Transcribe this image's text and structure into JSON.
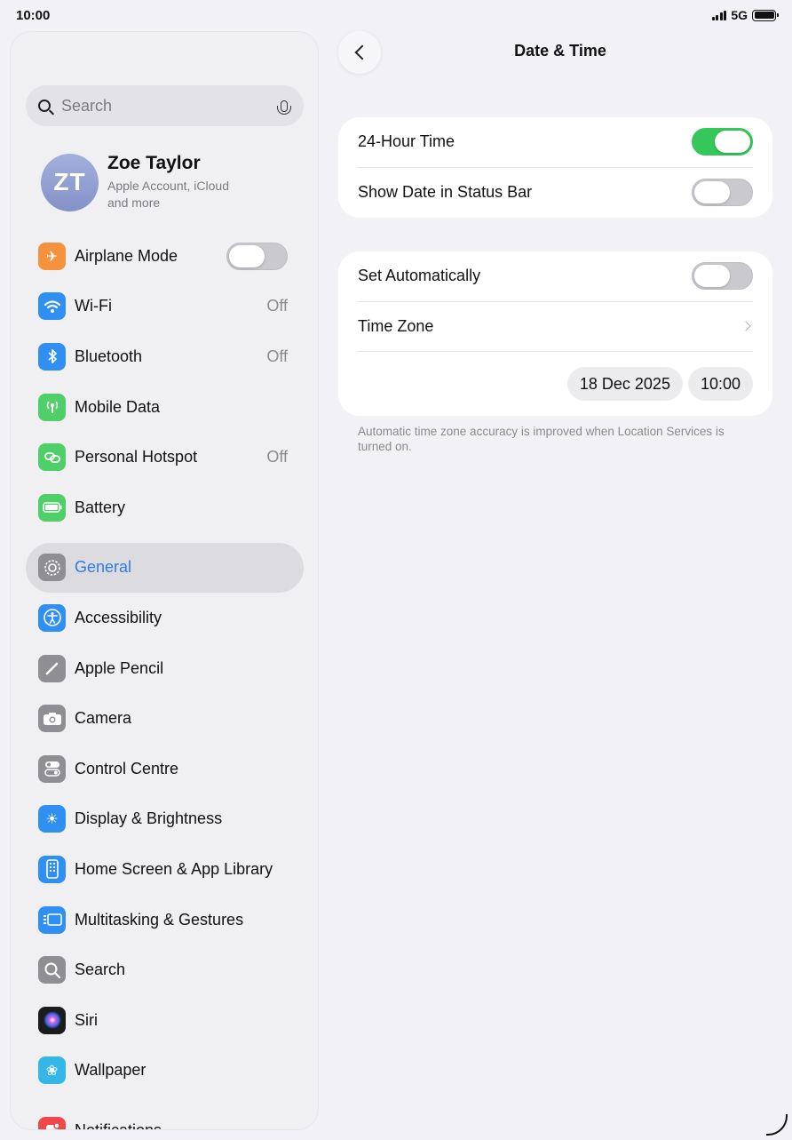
{
  "status_bar": {
    "time": "10:00",
    "network": "5G"
  },
  "sidebar": {
    "search_placeholder": "Search",
    "profile": {
      "initials": "ZT",
      "name": "Zoe Taylor",
      "subtitle": "Apple Account, iCloud and more"
    },
    "items": [
      {
        "label": "Airplane Mode",
        "value": "",
        "icon": "airplane-icon",
        "color": "#f5923e",
        "toggle": "off"
      },
      {
        "label": "Wi-Fi",
        "value": "Off",
        "icon": "wifi-icon",
        "color": "#2f8ff2"
      },
      {
        "label": "Bluetooth",
        "value": "Off",
        "icon": "bluetooth-icon",
        "color": "#2f8ff2"
      },
      {
        "label": "Mobile Data",
        "value": "",
        "icon": "antenna-icon",
        "color": "#4fcf68"
      },
      {
        "label": "Personal Hotspot",
        "value": "Off",
        "icon": "hotspot-icon",
        "color": "#4fcf68"
      },
      {
        "label": "Battery",
        "value": "",
        "icon": "battery-icon",
        "color": "#4fcf68"
      },
      {
        "label": "General",
        "value": "",
        "icon": "gear-icon",
        "color": "#8e8e93",
        "selected": true
      },
      {
        "label": "Accessibility",
        "value": "",
        "icon": "accessibility-icon",
        "color": "#2f8ff2"
      },
      {
        "label": "Apple Pencil",
        "value": "",
        "icon": "pencil-icon",
        "color": "#8e8e93"
      },
      {
        "label": "Camera",
        "value": "",
        "icon": "camera-icon",
        "color": "#8e8e93"
      },
      {
        "label": "Control Centre",
        "value": "",
        "icon": "toggles-icon",
        "color": "#8e8e93"
      },
      {
        "label": "Display & Brightness",
        "value": "",
        "icon": "sun-icon",
        "color": "#2f8ff2"
      },
      {
        "label": "Home Screen & App Library",
        "value": "",
        "icon": "home-screen-icon",
        "color": "#2f8ff2"
      },
      {
        "label": "Multitasking & Gestures",
        "value": "",
        "icon": "multitasking-icon",
        "color": "#2f8ff2"
      },
      {
        "label": "Search",
        "value": "",
        "icon": "search-icon",
        "color": "#8e8e93"
      },
      {
        "label": "Siri",
        "value": "",
        "icon": "siri-icon",
        "color": "#222222"
      },
      {
        "label": "Wallpaper",
        "value": "",
        "icon": "flower-icon",
        "color": "#35b6e9"
      },
      {
        "label": "Notifications",
        "value": "",
        "icon": "notifications-icon",
        "color": "#f04848"
      }
    ]
  },
  "detail": {
    "title": "Date & Time",
    "group1": {
      "hour24_label": "24-Hour Time",
      "hour24_on": true,
      "show_date_label": "Show Date in Status Bar",
      "show_date_on": false
    },
    "group2": {
      "set_auto_label": "Set Automatically",
      "set_auto_on": false,
      "time_zone_label": "Time Zone",
      "date_value": "18 Dec 2025",
      "time_value": "10:00"
    },
    "footnote": "Automatic time zone accuracy is improved when Location Services is turned on."
  }
}
